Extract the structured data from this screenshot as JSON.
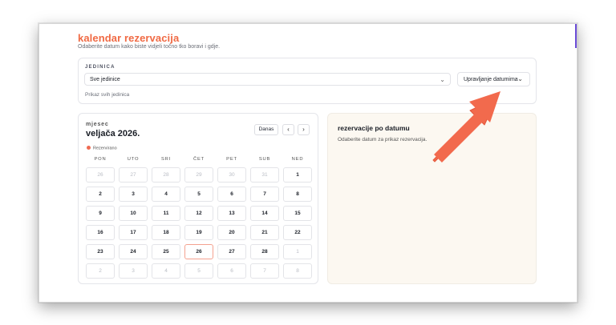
{
  "header": {
    "title": "kalendar rezervacija",
    "subtitle": "Odaberite datum kako biste vidjeli točno tko boravi i gdje."
  },
  "units": {
    "label": "JEDINICA",
    "selected": "Sve jedinice",
    "manage_label": "Upravljanje datumima",
    "hint": "Prikaz svih jedinica"
  },
  "calendar": {
    "view_label": "mjesec",
    "month_title": "veljača 2026.",
    "today_label": "Danas",
    "prev_icon": "chevron-left-icon",
    "next_icon": "chevron-right-icon",
    "legend_label": "Rezervirano",
    "legend_color": "#ef6b52",
    "weekdays": [
      "PON",
      "UTO",
      "SRI",
      "ČET",
      "PET",
      "SUB",
      "NED"
    ],
    "days": [
      {
        "d": "26",
        "muted": true
      },
      {
        "d": "27",
        "muted": true
      },
      {
        "d": "28",
        "muted": true
      },
      {
        "d": "29",
        "muted": true
      },
      {
        "d": "30",
        "muted": true
      },
      {
        "d": "31",
        "muted": true
      },
      {
        "d": "1",
        "muted": false
      },
      {
        "d": "2",
        "muted": false
      },
      {
        "d": "3",
        "muted": false
      },
      {
        "d": "4",
        "muted": false
      },
      {
        "d": "5",
        "muted": false
      },
      {
        "d": "6",
        "muted": false
      },
      {
        "d": "7",
        "muted": false
      },
      {
        "d": "8",
        "muted": false
      },
      {
        "d": "9",
        "muted": false
      },
      {
        "d": "10",
        "muted": false
      },
      {
        "d": "11",
        "muted": false
      },
      {
        "d": "12",
        "muted": false
      },
      {
        "d": "13",
        "muted": false
      },
      {
        "d": "14",
        "muted": false
      },
      {
        "d": "15",
        "muted": false
      },
      {
        "d": "16",
        "muted": false
      },
      {
        "d": "17",
        "muted": false
      },
      {
        "d": "18",
        "muted": false
      },
      {
        "d": "19",
        "muted": false
      },
      {
        "d": "20",
        "muted": false
      },
      {
        "d": "21",
        "muted": false
      },
      {
        "d": "22",
        "muted": false
      },
      {
        "d": "23",
        "muted": false
      },
      {
        "d": "24",
        "muted": false
      },
      {
        "d": "25",
        "muted": false
      },
      {
        "d": "26",
        "muted": false,
        "today": true
      },
      {
        "d": "27",
        "muted": false
      },
      {
        "d": "28",
        "muted": false
      },
      {
        "d": "1",
        "muted": true
      },
      {
        "d": "2",
        "muted": true
      },
      {
        "d": "3",
        "muted": true
      },
      {
        "d": "4",
        "muted": true
      },
      {
        "d": "5",
        "muted": true
      },
      {
        "d": "6",
        "muted": true
      },
      {
        "d": "7",
        "muted": true
      },
      {
        "d": "8",
        "muted": true
      }
    ]
  },
  "reservations": {
    "title": "rezervacije po datumu",
    "empty_hint": "Odaberite datum za prikaz rezervacija."
  },
  "colors": {
    "accent": "#f06a44",
    "arrow": "#f26a4d",
    "panel_bg": "#fcf8f1"
  }
}
